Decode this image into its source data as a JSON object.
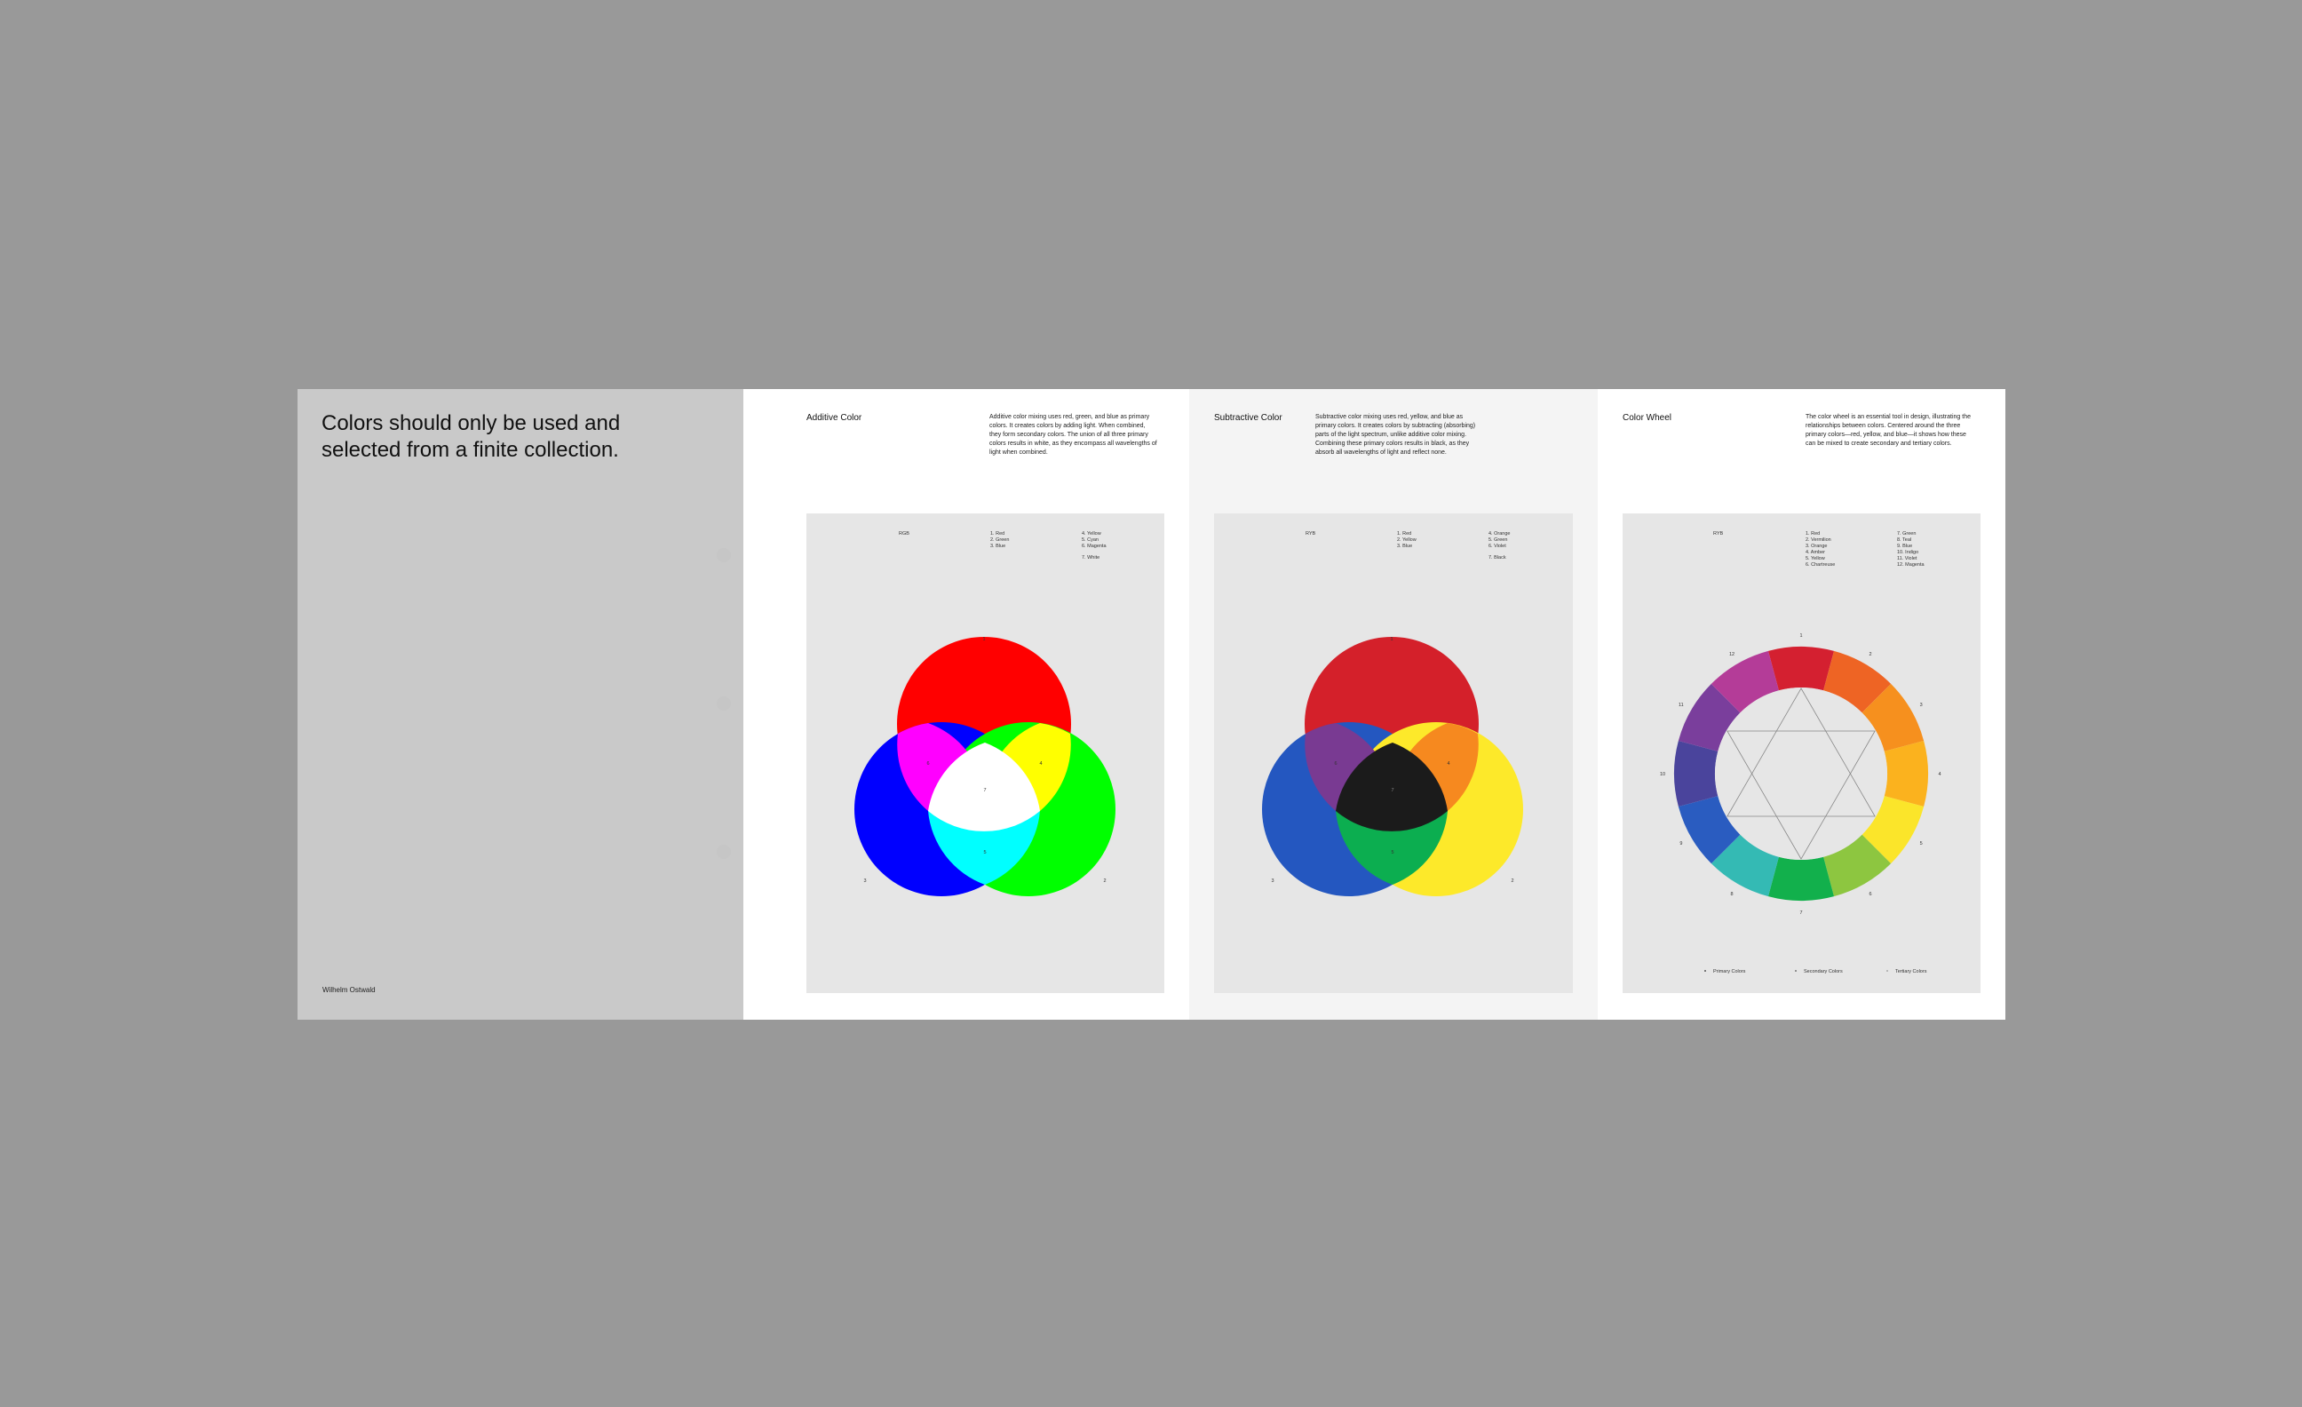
{
  "cover": {
    "title": "Colors should only be used and selected from a finite collection.",
    "author": "Wilhelm Ostwald"
  },
  "additive": {
    "title": "Additive Color",
    "description": "Additive color mixing uses red, green, and blue as primary colors. It creates colors by adding light. When combined, they form secondary colors. The union of all three primary colors results in white, as they encompass all wavelengths of light when combined.",
    "model": "RGB",
    "legend": [
      "1.  Red",
      "2.  Green",
      "3.  Blue",
      "4.  Yellow",
      "5.  Cyan",
      "6.  Magenta",
      "7.  White"
    ],
    "labels": [
      "1",
      "2",
      "3",
      "4",
      "5",
      "6",
      "7"
    ]
  },
  "subtractive": {
    "title": "Subtractive Color",
    "description": "Subtractive color mixing uses red, yellow, and blue as primary colors. It creates colors by subtracting (absorbing) parts of the light spectrum, unlike additive color mixing. Combining these primary colors results in black, as they absorb all wavelengths of light and reflect none.",
    "model": "RYB",
    "legend": [
      "1.  Red",
      "2.  Yellow",
      "3.  Blue",
      "4.  Orange",
      "5.  Green",
      "6.  Violet",
      "7.  Black"
    ],
    "labels": [
      "1",
      "2",
      "3",
      "4",
      "5",
      "6",
      "7"
    ]
  },
  "wheel": {
    "title": "Color Wheel",
    "description": "The color wheel is an essential tool in design, illustrating the relationships between colors. Centered around the three primary colors—red, yellow, and blue—it shows how these can be mixed to create secondary and tertiary colors.",
    "model": "RYB",
    "legend": [
      "1.  Red",
      "2.  Vermilion",
      "3.  Orange",
      "4.  Amber",
      "5.  Yellow",
      "6.  Chartreuse",
      "7.  Green",
      "8.  Teal",
      "9.  Blue",
      "10. Indigo",
      "11. Violet",
      "12. Magenta"
    ],
    "numbers": [
      "1",
      "2",
      "3",
      "4",
      "5",
      "6",
      "7",
      "8",
      "9",
      "10",
      "11",
      "12"
    ],
    "key": [
      "Primary Colors",
      "Secondary Colors",
      "Tertiary Colors"
    ],
    "segment_colors": [
      "#d42030",
      "#ee6424",
      "#f6901e",
      "#fbb21e",
      "#fbe52a",
      "#8dc640",
      "#12b04c",
      "#34bab4",
      "#2a5cc0",
      "#4a449c",
      "#7a3e9c",
      "#b43c98"
    ]
  },
  "colors": {
    "rgb_red": "#ff0000",
    "rgb_green": "#00ff00",
    "rgb_blue": "#0000ff",
    "ryb_red": "#d4202a",
    "ryb_yellow": "#fde92a",
    "ryb_blue": "#2457c0",
    "ryb_orange": "#f6891f",
    "ryb_green": "#0cae50",
    "ryb_violet": "#793a92",
    "ryb_black": "#1b1b1b"
  }
}
